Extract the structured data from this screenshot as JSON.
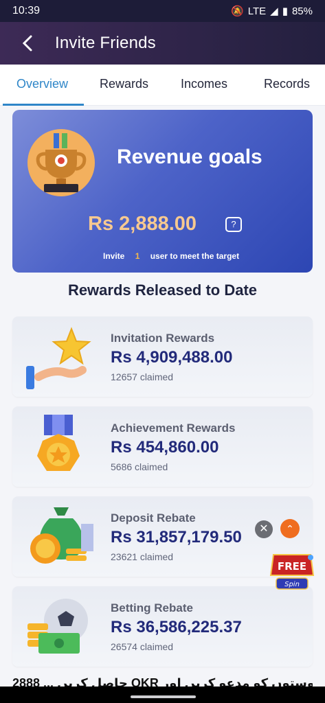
{
  "status": {
    "time": "10:39",
    "network": "LTE",
    "battery": "85%"
  },
  "header": {
    "title": "Invite Friends"
  },
  "tabs": [
    {
      "label": "Overview"
    },
    {
      "label": "Rewards"
    },
    {
      "label": "Incomes"
    },
    {
      "label": "Records"
    }
  ],
  "goal": {
    "title": "Revenue goals",
    "amount": "Rs  2,888.00",
    "invite_prefix": "Invite",
    "invite_count": "1",
    "invite_suffix": "user to meet the target"
  },
  "section_title": "Rewards Released to Date",
  "rewards": [
    {
      "name": "Invitation Rewards",
      "amount": "Rs  4,909,488.00",
      "claimed": "12657 claimed"
    },
    {
      "name": "Achievement Rewards",
      "amount": "Rs  454,860.00",
      "claimed": "5686 claimed"
    },
    {
      "name": "Deposit Rebate",
      "amount": "Rs  31,857,179.50",
      "claimed": "23621 claimed"
    },
    {
      "name": "Betting Rebate",
      "amount": "Rs  36,586,225.37",
      "claimed": "26574 claimed"
    }
  ],
  "free_spin": {
    "line1": "FREE",
    "line2": "Spin"
  },
  "footer_text": "2888 ... جاصل کریں OKR دوستوں کو مدعو کریں اور",
  "icons": {
    "back": "chevron-left-icon",
    "help": "question-bubble-icon",
    "close": "close-icon",
    "scroll_up": "double-chevron-up-icon"
  },
  "colors": {
    "accent": "#2f86c8",
    "amount": "#222a7a",
    "goal_amount": "#f7c990"
  }
}
